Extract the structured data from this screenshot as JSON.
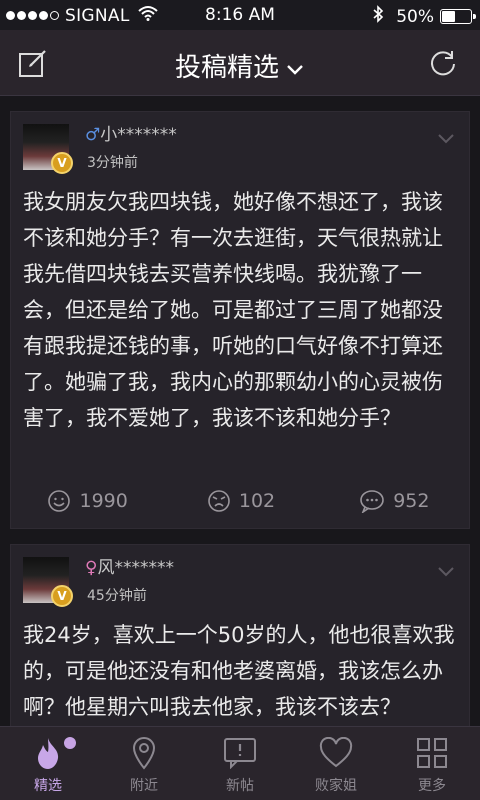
{
  "status_bar": {
    "carrier": "SIGNAL",
    "time": "8:16 AM",
    "battery": "50%",
    "battery_level": 0.5
  },
  "nav": {
    "title": "投稿精选",
    "left_icon": "compose-icon",
    "right_icon": "refresh-icon"
  },
  "posts": [
    {
      "gender": "♂",
      "username": "小*******",
      "time_ago": "3分钟前",
      "badge": "V",
      "content": "我女朋友欠我四块钱，她好像不想还了，我该不该和她分手？有一次去逛街，天气很热就让我先借四块钱去买营养快线喝。我犹豫了一会，但还是给了她。可是都过了三周了她都没有跟我提还钱的事，听她的口气好像不打算还了。她骗了我，我内心的那颗幼小的心灵被伤害了，我不爱她了，我该不该和她分手？",
      "likes": "1990",
      "dislikes": "102",
      "comments": "952"
    },
    {
      "gender": "♀",
      "username": "风*******",
      "time_ago": "45分钟前",
      "badge": "V",
      "content": "我24岁，喜欢上一个50岁的人，他也很喜欢我的，可是他还没有和他老婆离婚，我该怎么办啊？他星期六叫我去他家，我该不该去？"
    }
  ],
  "tabs": [
    {
      "label": "精选",
      "icon": "flame-icon",
      "active": true
    },
    {
      "label": "附近",
      "icon": "location-pin-icon"
    },
    {
      "label": "新帖",
      "icon": "new-post-icon"
    },
    {
      "label": "败家姐",
      "icon": "heart-icon"
    },
    {
      "label": "更多",
      "icon": "grid-icon"
    }
  ],
  "colors": {
    "background": "#18171b",
    "card": "#26232a",
    "bar": "#2a252c",
    "accent": "#c8a7e8",
    "male": "#5a8fe0",
    "female": "#e07ab8"
  }
}
